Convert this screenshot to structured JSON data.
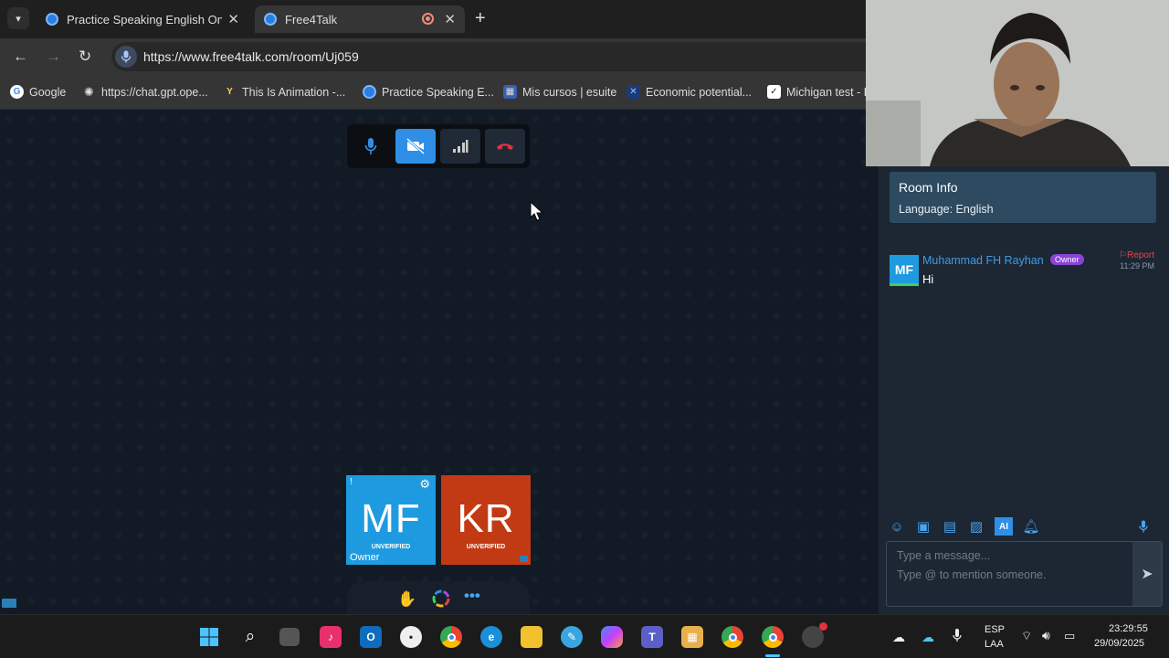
{
  "browser": {
    "tabs": [
      {
        "title": "Practice Speaking English Onlin"
      },
      {
        "title": "Free4Talk"
      }
    ],
    "url": "https://www.free4talk.com/room/Uj059",
    "bookmarks": [
      {
        "label": "Google"
      },
      {
        "label": "https://chat.gpt.ope..."
      },
      {
        "label": "This Is Animation -..."
      },
      {
        "label": "Practice Speaking E..."
      },
      {
        "label": "Mis cursos | esuite"
      },
      {
        "label": "Economic potential..."
      },
      {
        "label": "Michigan test - E"
      }
    ]
  },
  "call": {
    "tiles": [
      {
        "initials": "MF",
        "status": "UNVERIFIED",
        "role": "Owner",
        "color": "#1e9be0"
      },
      {
        "initials": "KR",
        "status": "UNVERIFIED",
        "color": "#c23a14"
      }
    ]
  },
  "room_info": {
    "title": "Room Info",
    "language": "Language: English"
  },
  "chat": {
    "messages": [
      {
        "avatar": "MF",
        "sender": "Muhammad FH Rayhan",
        "badge": "Owner",
        "text": "Hi",
        "report": "Report",
        "time": "11:29 PM"
      }
    ],
    "placeholder_line1": "Type a message...",
    "placeholder_line2": "Type @ to mention someone."
  },
  "taskbar": {
    "lang_top": "ESP",
    "lang_bottom": "LAA",
    "time": "23:29:55",
    "date": "29/09/2025"
  },
  "colors": {
    "accent": "#1e9be0",
    "danger": "#e64545",
    "owner_badge": "#8a43d6"
  }
}
